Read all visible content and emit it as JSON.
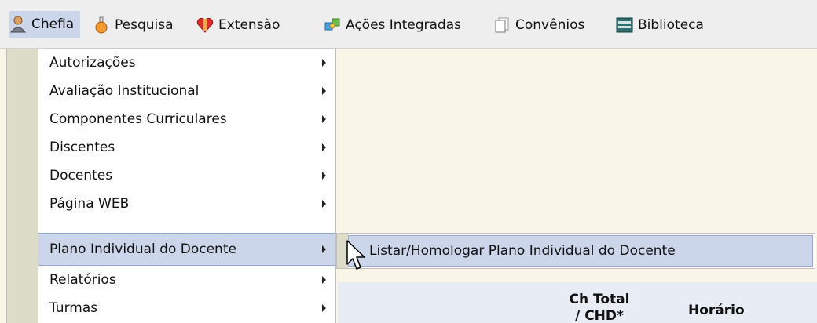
{
  "menubar": {
    "items": [
      {
        "label": "Chefia",
        "icon": "user-icon"
      },
      {
        "label": "Pesquisa",
        "icon": "flask-icon"
      },
      {
        "label": "Extensão",
        "icon": "heart-gift-icon"
      },
      {
        "label": "Ações Integradas",
        "icon": "puzzle-icon"
      },
      {
        "label": "Convênios",
        "icon": "documents-icon"
      },
      {
        "label": "Biblioteca",
        "icon": "books-icon"
      }
    ]
  },
  "dropdown": {
    "items": [
      {
        "label": "Autorizações"
      },
      {
        "label": "Avaliação Institucional"
      },
      {
        "label": "Componentes Curriculares"
      },
      {
        "label": "Discentes"
      },
      {
        "label": "Docentes"
      },
      {
        "label": "Página WEB"
      },
      {
        "label": "Plano Individual do Docente"
      },
      {
        "label": "Relatórios"
      },
      {
        "label": "Turmas"
      }
    ]
  },
  "submenu": {
    "item_label": "Listar/Homologar Plano Individual do Docente"
  },
  "table": {
    "col_ch_line1": "Ch Total",
    "col_ch_line2": "/ CHD*",
    "col_horario": "Horário"
  },
  "colors": {
    "highlight": "#ccd6ea",
    "background": "#f9f6e7",
    "gutter": "#dcdcc8"
  }
}
